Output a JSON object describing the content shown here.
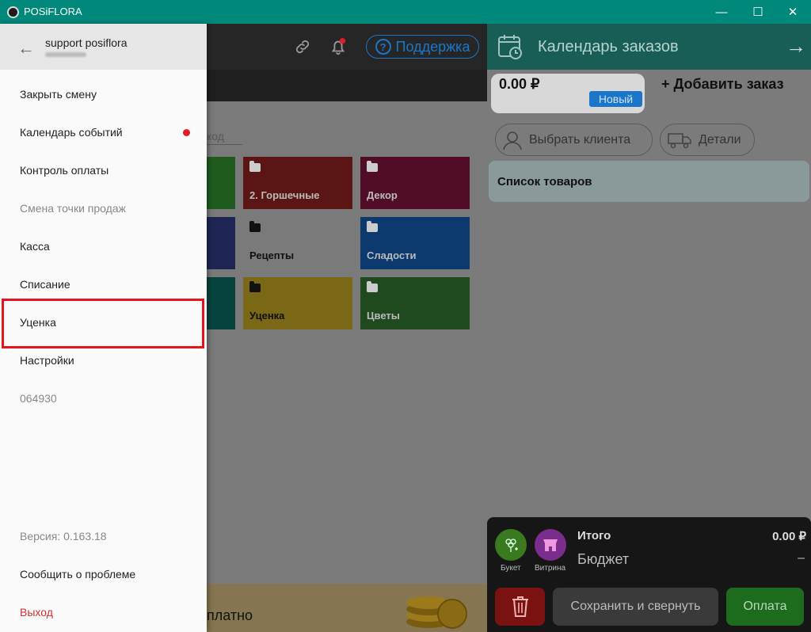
{
  "window": {
    "title": "POSiFLORA",
    "min": "—",
    "max": "☐",
    "close": "✕"
  },
  "main": {
    "support_label": "Поддержка",
    "search_fragment": "код",
    "tiles": [
      {
        "label": "2. Горшечные"
      },
      {
        "label": "Декор"
      },
      {
        "label": "Рецепты"
      },
      {
        "label": "Сладости"
      },
      {
        "label": "Уценка"
      },
      {
        "label": "Цветы"
      }
    ],
    "banner_text": "платно"
  },
  "drawer": {
    "user": "support posiflora",
    "items": [
      "Закрыть смену",
      "Календарь событий",
      "Контроль оплаты",
      "Смена точки продаж",
      "Касса",
      "Списание",
      "Уценка",
      "Настройки",
      "064930"
    ],
    "version": "Версия: 0.163.18",
    "report": "Сообщить о проблеме",
    "logout": "Выход"
  },
  "order_panel": {
    "title": "Календарь заказов",
    "amount": "0.00 ₽",
    "badge": "Новый",
    "add_order": "+ Добавить заказ",
    "choose_client": "Выбрать клиента",
    "details": "Детали",
    "goods_list": "Список товаров",
    "bouquet_label": "Букет",
    "showcase_label": "Витрина",
    "total_label": "Итого",
    "total_value": "0.00 ₽",
    "budget_label": "Бюджет",
    "budget_value": "–",
    "save_label": "Сохранить и свернуть",
    "pay_label": "Оплата"
  }
}
